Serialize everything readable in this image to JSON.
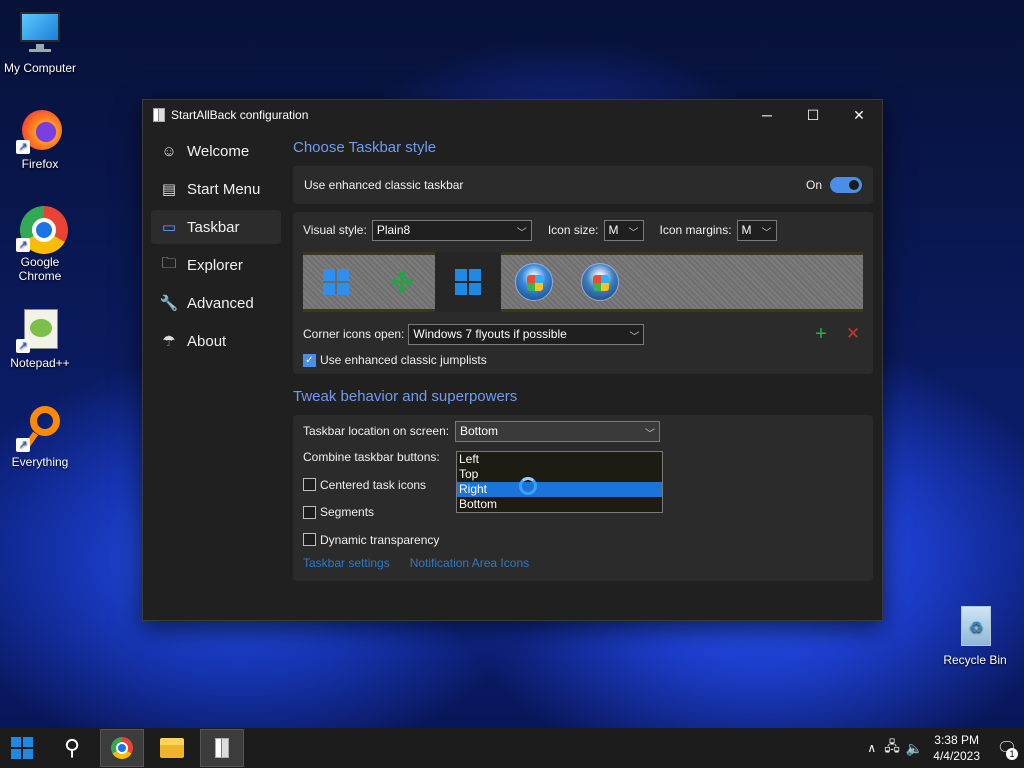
{
  "desktop": {
    "icons": [
      {
        "label": "My Computer"
      },
      {
        "label": "Firefox"
      },
      {
        "label": "Google Chrome"
      },
      {
        "label": "Notepad++"
      },
      {
        "label": "Everything"
      },
      {
        "label": "Recycle Bin"
      }
    ]
  },
  "window": {
    "title": "StartAllBack configuration",
    "sidebar": {
      "items": [
        {
          "label": "Welcome",
          "icon": "smile-icon"
        },
        {
          "label": "Start Menu",
          "icon": "start-menu-icon"
        },
        {
          "label": "Taskbar",
          "icon": "taskbar-icon"
        },
        {
          "label": "Explorer",
          "icon": "explorer-icon"
        },
        {
          "label": "Advanced",
          "icon": "wrench-icon"
        },
        {
          "label": "About",
          "icon": "about-icon"
        }
      ],
      "active": "Taskbar"
    },
    "style_section": {
      "title": "Choose Taskbar style",
      "enhanced_label": "Use enhanced classic taskbar",
      "enhanced_state": "On",
      "visual_style_label": "Visual style:",
      "visual_style_value": "Plain8",
      "icon_size_label": "Icon size:",
      "icon_size_value": "M",
      "icon_margins_label": "Icon margins:",
      "icon_margins_value": "M",
      "corner_icons_label": "Corner icons open:",
      "corner_icons_value": "Windows 7 flyouts if possible",
      "jumplists_label": "Use enhanced classic jumplists",
      "jumplists_checked": true
    },
    "behavior_section": {
      "title": "Tweak behavior and superpowers",
      "location_label": "Taskbar location on screen:",
      "location_value": "Bottom",
      "location_options": [
        "Left",
        "Top",
        "Right",
        "Bottom"
      ],
      "location_highlighted": "Right",
      "combine_label": "Combine taskbar buttons:",
      "centered_label": "Centered task icons",
      "segments_label": "Segments",
      "transparency_label": "Dynamic transparency",
      "link_taskbar_settings": "Taskbar settings",
      "link_notification_icons": "Notification Area Icons"
    }
  },
  "taskbar": {
    "time": "3:38 PM",
    "date": "4/4/2023",
    "notification_count": "1"
  }
}
